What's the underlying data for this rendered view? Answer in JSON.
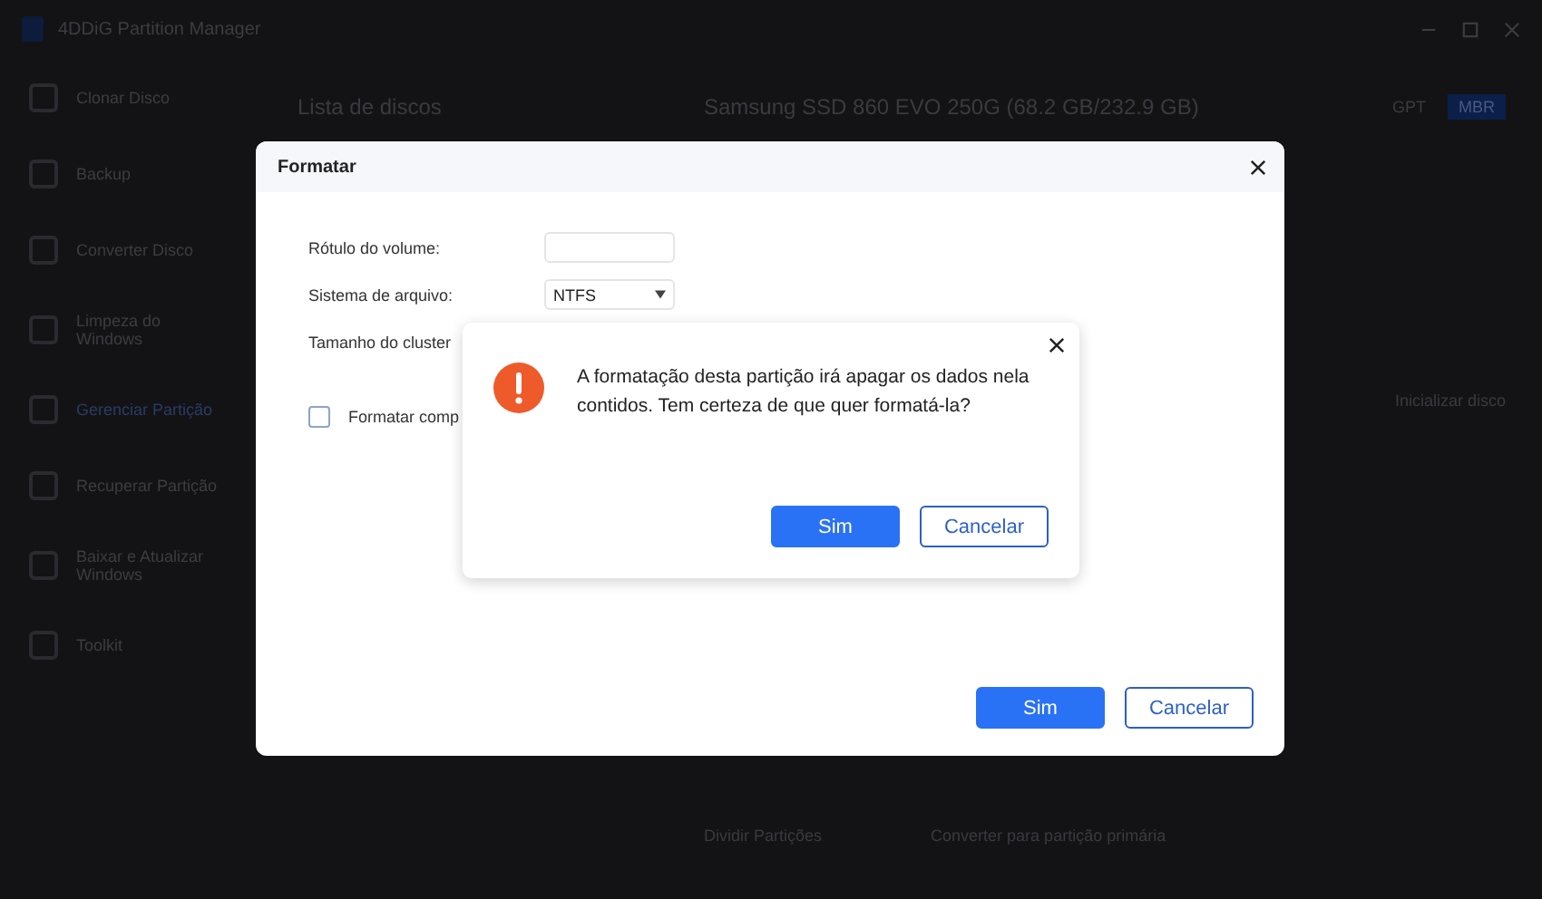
{
  "app": {
    "title": "4DDiG Partition Manager"
  },
  "sidebar": {
    "items": [
      {
        "label": "Clonar Disco",
        "selected": false
      },
      {
        "label": "Backup",
        "selected": false
      },
      {
        "label": "Converter Disco",
        "selected": false
      },
      {
        "label": "Limpeza do Windows",
        "selected": false
      },
      {
        "label": "Gerenciar Partição",
        "selected": true
      },
      {
        "label": "Recuperar Partição",
        "selected": false
      },
      {
        "label": "Baixar e Atualizar Windows",
        "selected": false
      },
      {
        "label": "Toolkit",
        "selected": false
      }
    ]
  },
  "disk_list": {
    "title": "Lista de discos"
  },
  "disk_panel": {
    "title": "Samsung SSD 860 EVO 250G (68.2 GB/232.9 GB)",
    "tabs": [
      {
        "label": "GPT",
        "selected": false
      },
      {
        "label": "MBR",
        "selected": true
      }
    ],
    "actions": [
      "Inicializar disco"
    ],
    "partition_actions": [
      "Dividir Partições",
      "Converter para partição primária"
    ]
  },
  "format_dialog": {
    "title": "Formatar",
    "fields": [
      {
        "kind": "text",
        "label": "Rótulo do volume:"
      },
      {
        "kind": "select",
        "label": "Sistema de arquivo:",
        "value": "NTFS"
      },
      {
        "kind": "label",
        "label": "Tamanho do cluster"
      }
    ],
    "checkbox": {
      "label": "Formatar comp",
      "checked": false
    },
    "buttons": [
      {
        "label": "Sim",
        "primary": true
      },
      {
        "label": "Cancelar",
        "primary": false
      }
    ]
  },
  "confirm_dialog": {
    "message": "A formatação desta partição irá apagar os dados nela contidos. Tem certeza de que quer formatá-la?",
    "buttons": [
      {
        "label": "Sim",
        "primary": true
      },
      {
        "label": "Cancelar",
        "primary": false
      }
    ]
  }
}
